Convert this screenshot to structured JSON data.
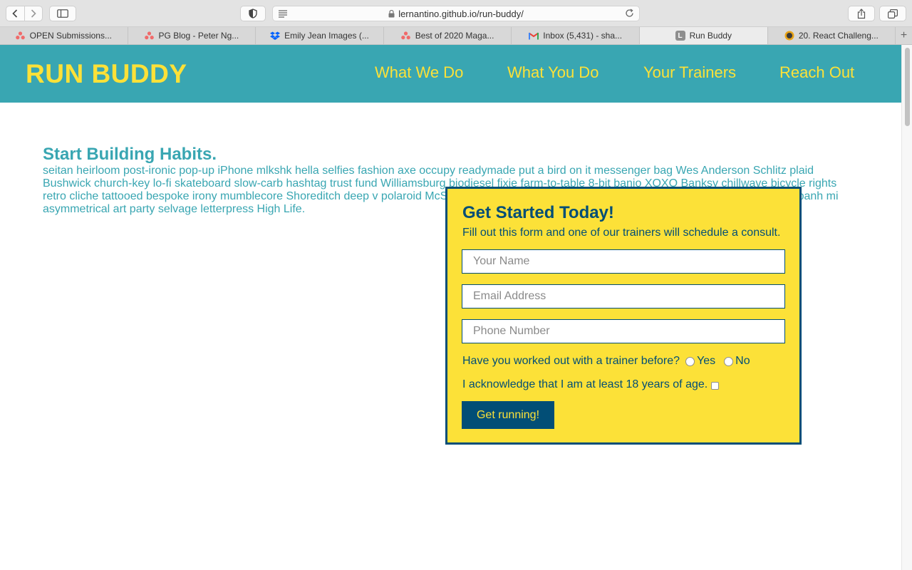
{
  "browser": {
    "url": "lernantino.github.io/run-buddy/",
    "tabs": [
      {
        "label": "OPEN Submissions...",
        "icon": "asana-icon",
        "color": "#f06a6a",
        "active": false
      },
      {
        "label": "PG Blog - Peter Ng...",
        "icon": "asana-icon",
        "color": "#f06a6a",
        "active": false
      },
      {
        "label": "Emily Jean Images (...",
        "icon": "dropbox-icon",
        "color": "#0061fe",
        "active": false
      },
      {
        "label": "Best of 2020 Maga...",
        "icon": "asana-icon",
        "color": "#f06a6a",
        "active": false
      },
      {
        "label": "Inbox (5,431) - sha...",
        "icon": "gmail-icon",
        "color": "#ea4335",
        "active": false
      },
      {
        "label": "Run Buddy",
        "icon": "letter-l-icon",
        "color": "#8e8e8e",
        "active": true
      },
      {
        "label": "20. React Challeng...",
        "icon": "edx-icon",
        "color": "#e8a317",
        "active": false
      }
    ],
    "new_tab": "+"
  },
  "site": {
    "logo": "RUN BUDDY",
    "nav": [
      "What We Do",
      "What You Do",
      "Your Trainers",
      "Reach Out"
    ],
    "colors": {
      "primary": "#39a6b2",
      "accent": "#fce138",
      "dark": "#024e76"
    }
  },
  "hero": {
    "title": "Start Building Habits.",
    "text": "seitan heirloom post-ironic pop-up iPhone mlkshk hella selfies fashion axe occupy readymade put a bird on it messenger bag Wes Anderson Schlitz plaid Bushwick church-key lo-fi skateboard slow-carb hashtag trust fund Williamsburg biodiesel fixie farm-to-table 8-bit banjo XOXO Banksy chillwave bicycle rights retro cliche tattooed bespoke irony mumblecore Shoreditch deep v polaroid McSweeney's sustainable typewriter forage vinyl Marfa craft beer them yr banh mi asymmetrical art party selvage letterpress High Life."
  },
  "form": {
    "title": "Get Started Today!",
    "subtitle": "Fill out this form and one of our trainers will schedule a consult.",
    "name_placeholder": "Your Name",
    "email_placeholder": "Email Address",
    "phone_placeholder": "Phone Number",
    "question": "Have you worked out with a trainer before?",
    "yes": "Yes",
    "no": "No",
    "acknowledge": "I acknowledge that I am at least 18 years of age.",
    "submit": "Get running!"
  }
}
